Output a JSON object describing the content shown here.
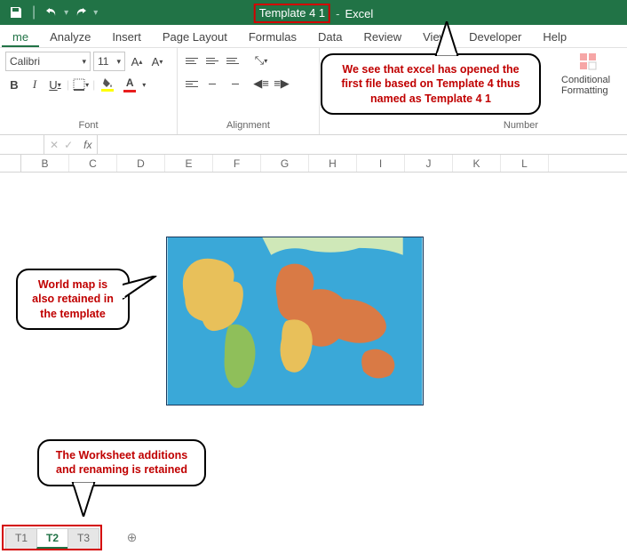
{
  "titlebar": {
    "filename": "Template 4 1",
    "app_label": "Excel"
  },
  "ribbon": {
    "tabs": [
      "me",
      "Analyze",
      "Insert",
      "Page Layout",
      "Formulas",
      "Data",
      "Review",
      "View",
      "Developer",
      "Help"
    ],
    "active_tab": "me",
    "font": {
      "name": "Calibri",
      "size": "11",
      "group_label": "Font"
    },
    "alignment": {
      "group_label": "Alignment"
    },
    "number": {
      "group_label": "Number"
    },
    "styles": {
      "cond_fmt": "Conditional Formatting"
    }
  },
  "formula_bar": {
    "fx": "fx"
  },
  "columns": [
    "B",
    "C",
    "D",
    "E",
    "F",
    "G",
    "H",
    "I",
    "J",
    "K",
    "L"
  ],
  "callouts": {
    "title": "We see that excel has opened the first file based on Template 4 thus named as Template 4 1",
    "map": "World map is also retained in the template",
    "tabs": "The Worksheet additions and renaming is retained"
  },
  "sheet_tabs": {
    "items": [
      "T1",
      "T2",
      "T3"
    ],
    "active": "T2",
    "add": "⊕"
  }
}
